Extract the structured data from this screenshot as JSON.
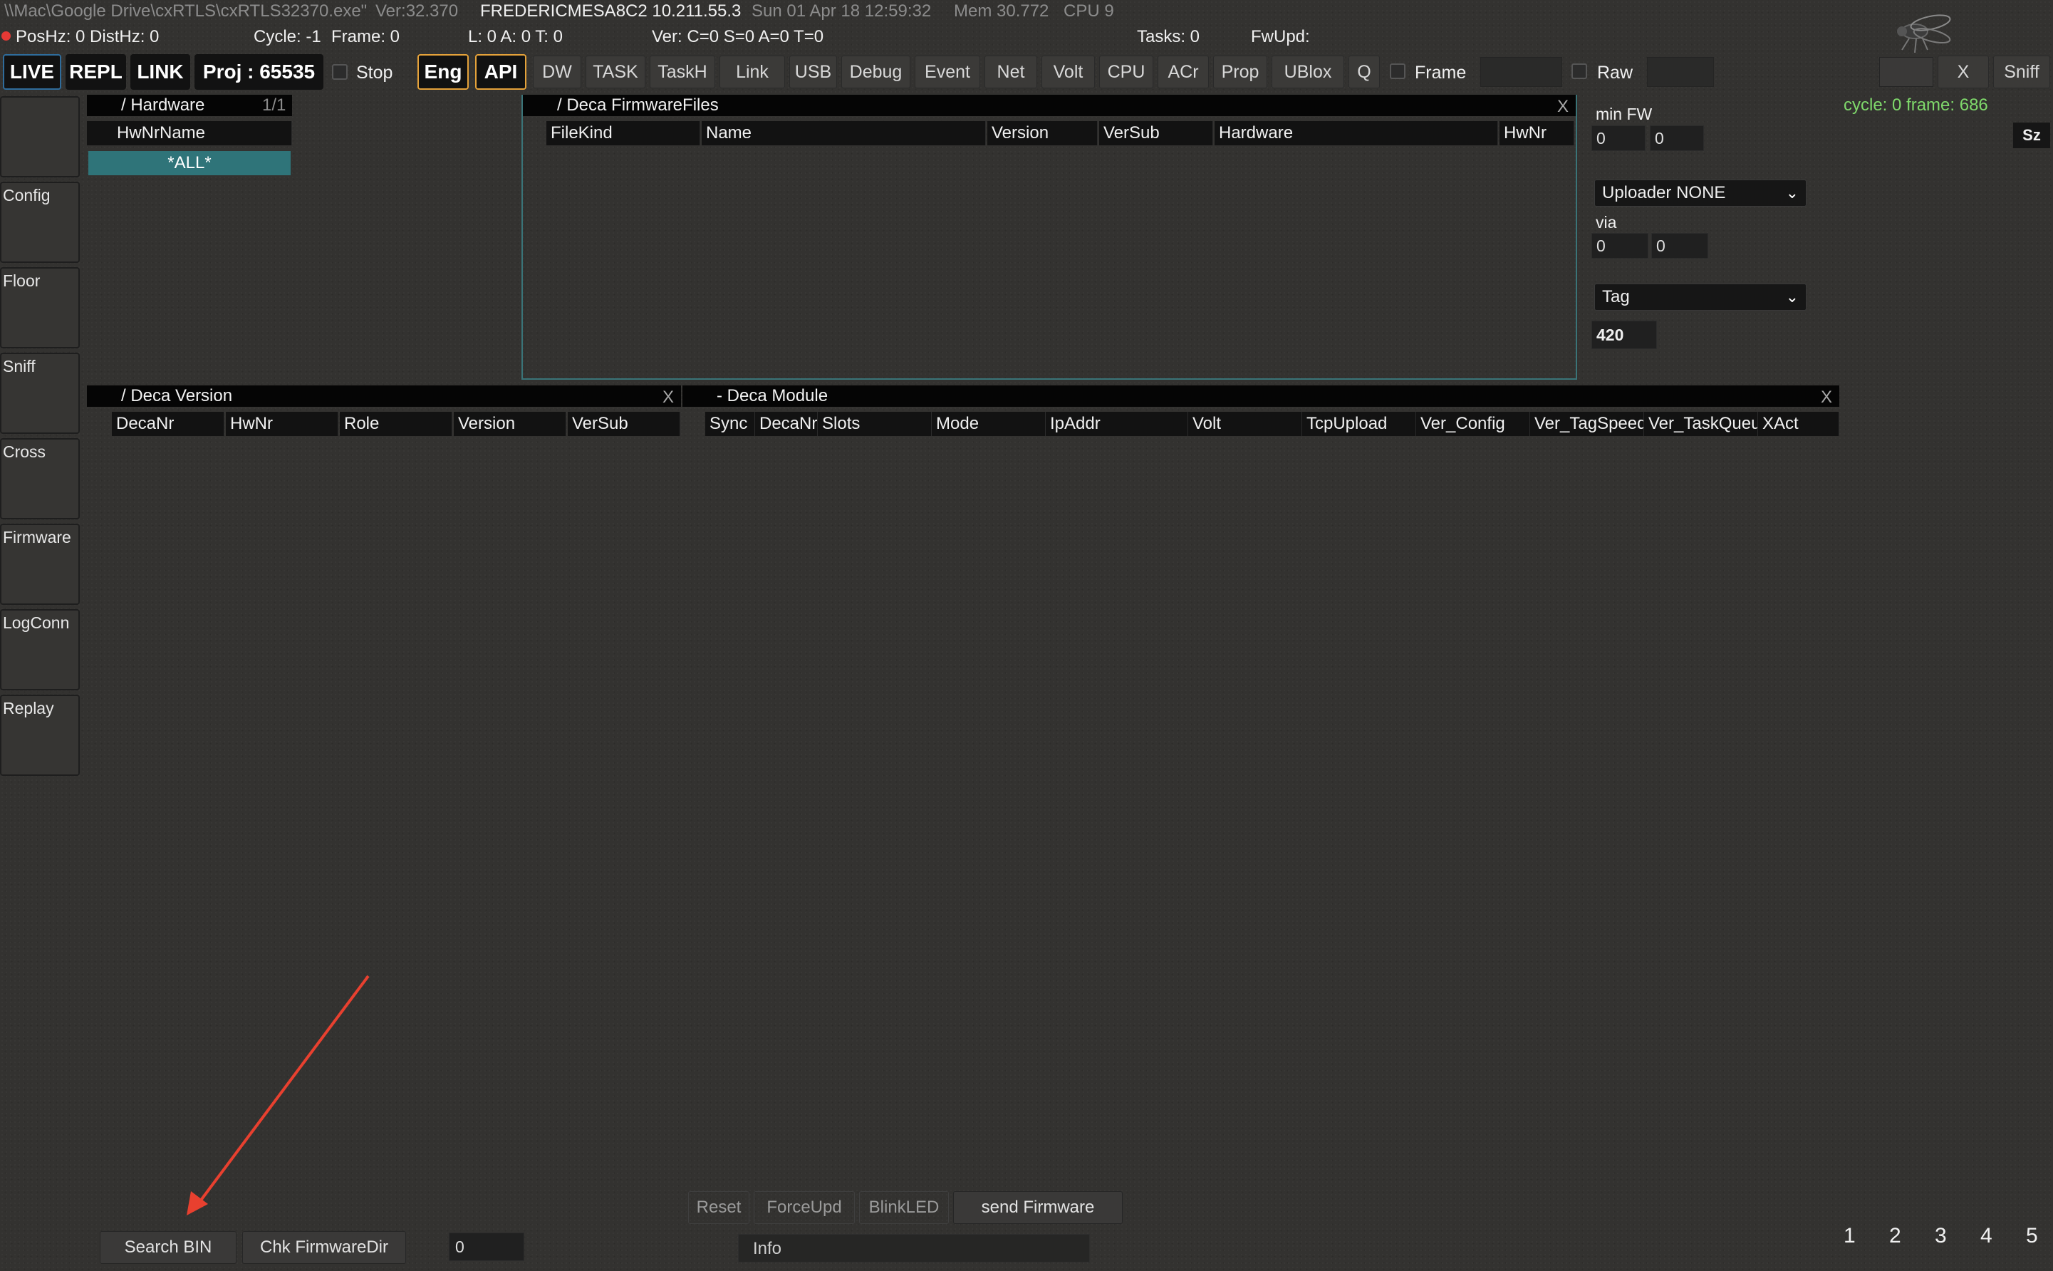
{
  "status_bar": {
    "exe_path": "\\\\Mac\\Google Drive\\cxRTLS\\cxRTLS32370.exe\"",
    "version": "Ver:32.370",
    "host": "FREDERICMESA8C2 10.211.55.3",
    "datetime": "Sun 01 Apr 18 12:59:32",
    "mem": "Mem 30.772",
    "cpu": "CPU 9",
    "poshz": "PosHz: 0 DistHz: 0",
    "cycle": "Cycle: -1",
    "frame": "Frame: 0",
    "lat": "L: 0  A: 0  T: 0",
    "ver_counts": "Ver: C=0 S=0 A=0 T=0",
    "tasks": "Tasks: 0",
    "fwupd": "FwUpd:",
    "status_dot_color": "#e53935"
  },
  "toolbar": {
    "live": "LIVE",
    "repl": "REPL",
    "link": "LINK",
    "proj": "Proj : 65535",
    "stop": "Stop",
    "eng": "Eng",
    "api": "API",
    "buttons": [
      "DW",
      "TASK",
      "TaskH",
      "Link",
      "USB",
      "Debug",
      "Event",
      "Net",
      "Volt",
      "CPU",
      "ACr",
      "Prop",
      "UBlox",
      "Q"
    ],
    "frame_label": "Frame",
    "raw_label": "Raw",
    "close": "X",
    "sniff": "Sniff",
    "accent_orange": "#e5a23a",
    "accent_blue": "#2f6c9b"
  },
  "sidebar": {
    "items": [
      "",
      "Config",
      "Floor",
      "Sniff",
      "Cross",
      "Firmware",
      "LogConn",
      "Replay"
    ]
  },
  "hardware_panel": {
    "title": "/ Hardware",
    "pager": "1/1",
    "column": "HwNrName",
    "selected": "*ALL*"
  },
  "firmware_panel": {
    "title": "/ Deca FirmwareFiles",
    "close": "X",
    "columns": [
      "FileKind",
      "Name",
      "Version",
      "VerSub",
      "Hardware",
      "HwNr"
    ]
  },
  "version_panel": {
    "title": "/ Deca Version",
    "close": "X",
    "columns": [
      "DecaNr",
      "HwNr",
      "Role",
      "Version",
      "VerSub"
    ]
  },
  "module_panel": {
    "title": "- Deca Module",
    "close": "X",
    "columns": [
      "Sync",
      "DecaNr",
      "Slots",
      "Mode",
      "IpAddr",
      "Volt",
      "TcpUpload",
      "Ver_Config",
      "Ver_TagSpeed",
      "Ver_TaskQueue",
      "XAct"
    ]
  },
  "right_panel": {
    "cycle_frame": "cycle: 0  frame: 686",
    "sz": "Sz",
    "min_fw_label": "min FW",
    "min_fw_a": "0",
    "min_fw_b": "0",
    "uploader": "Uploader NONE",
    "via_label": "via",
    "via_a": "0",
    "via_b": "0",
    "tag": "Tag",
    "tag_value": "420",
    "cycle_color": "#7fd96b"
  },
  "bottom": {
    "reset": "Reset",
    "forceupd": "ForceUpd",
    "blinkled": "BlinkLED",
    "send_firmware": "send Firmware",
    "search_bin": "Search BIN",
    "chk_firmwaredir": "Chk FirmwareDir",
    "count": "0",
    "info": "Info",
    "pages": [
      "1",
      "2",
      "3",
      "4",
      "5"
    ],
    "arrow_color": "#e8402f"
  }
}
